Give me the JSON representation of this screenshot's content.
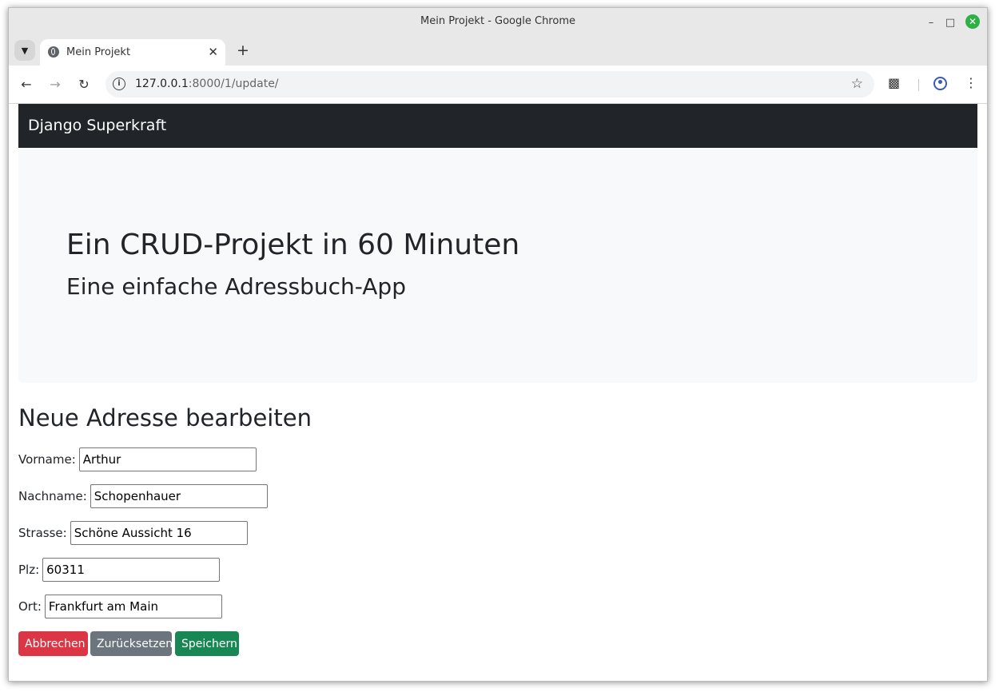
{
  "window": {
    "title": "Mein Projekt - Google Chrome"
  },
  "tab": {
    "title": "Mein Projekt"
  },
  "toolbar": {
    "url_host": "127.0.0.1",
    "url_path": ":8000/1/update/"
  },
  "navbar": {
    "brand": "Django Superkraft"
  },
  "jumbotron": {
    "title": "Ein CRUD-Projekt in 60 Minuten",
    "subtitle": "Eine einfache Adressbuch-App"
  },
  "form": {
    "heading": "Neue Adresse bearbeiten",
    "fields": [
      {
        "label": "Vorname:",
        "value": "Arthur"
      },
      {
        "label": "Nachname:",
        "value": "Schopenhauer"
      },
      {
        "label": "Strasse:",
        "value": "Schöne Aussicht 16"
      },
      {
        "label": "Plz:",
        "value": "60311"
      },
      {
        "label": "Ort:",
        "value": "Frankfurt am Main"
      }
    ],
    "buttons": {
      "cancel": "Abbrechen",
      "reset": "Zurücksetzen",
      "save": "Speichern"
    }
  },
  "colors": {
    "navbar": "#212529",
    "jumbotron": "#f8f9fa",
    "danger": "#dc3545",
    "secondary": "#6c757d",
    "success": "#198754"
  }
}
